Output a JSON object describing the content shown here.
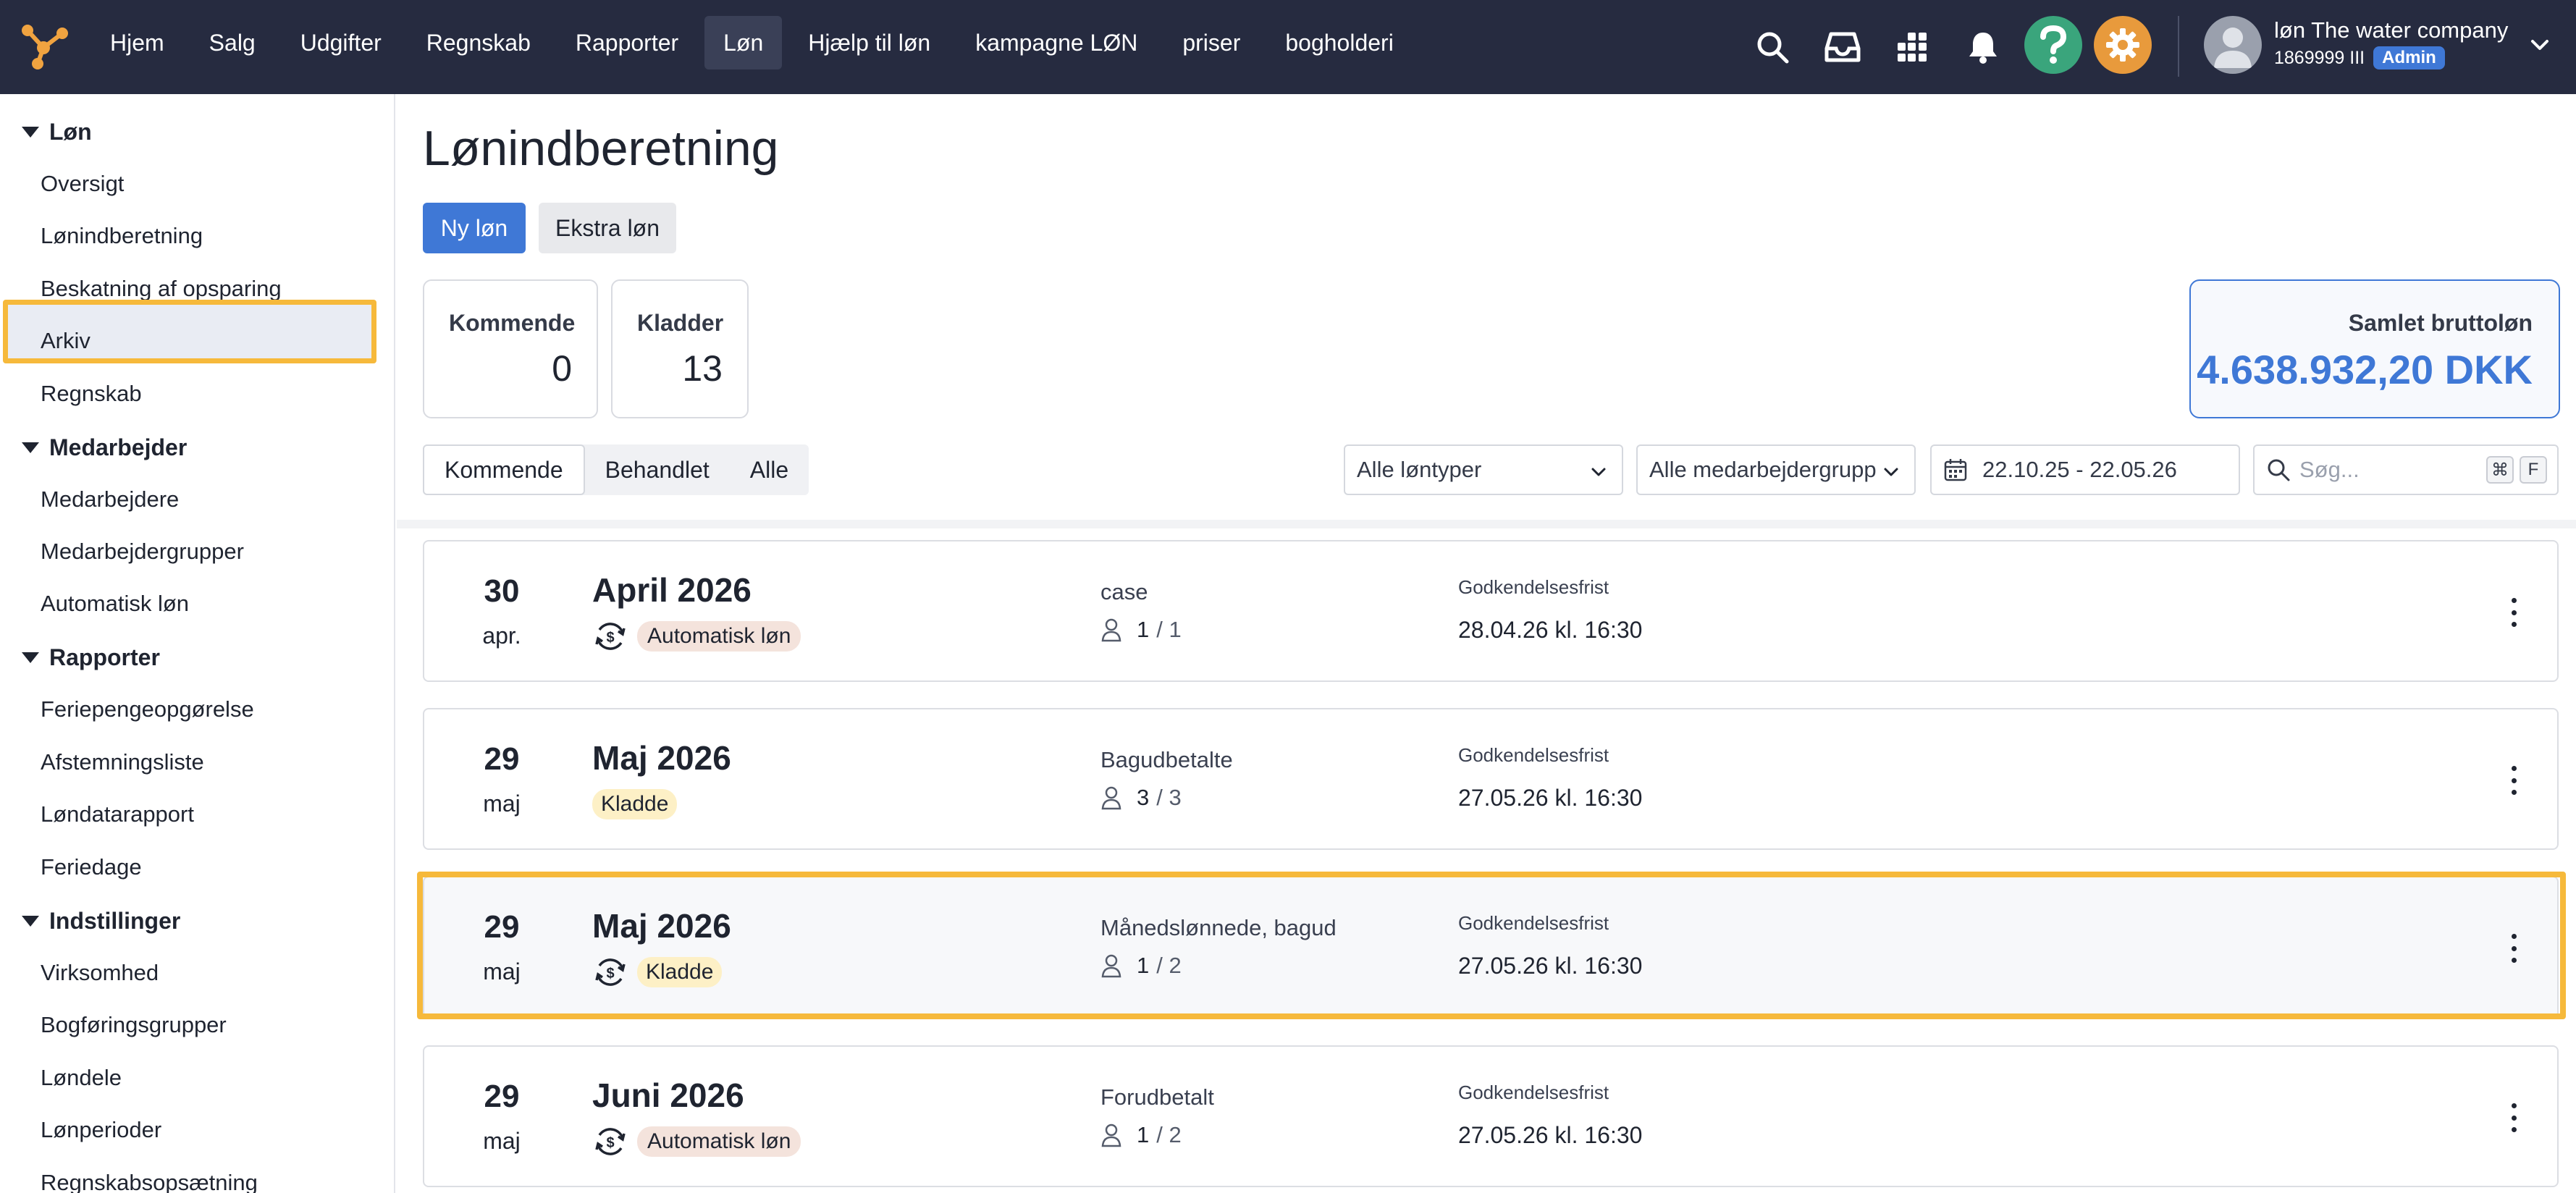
{
  "nav": {
    "items": [
      "Hjem",
      "Salg",
      "Udgifter",
      "Regnskab",
      "Rapporter",
      "Løn",
      "Hjælp til løn",
      "kampagne LØN",
      "priser",
      "bogholderi"
    ],
    "active": "Løn"
  },
  "icons": {
    "search": "search-icon",
    "inbox": "inbox-icon",
    "apps": "apps-grid-icon",
    "bell": "bell-icon",
    "help": "help-icon",
    "settings": "gear-icon"
  },
  "colors": {
    "topbar": "#262b40",
    "accent": "#3f78d6",
    "help": "#3aa57c",
    "settings": "#e89a3c",
    "highlight": "#f6b93b",
    "tag_auto": "#f4e3dc",
    "tag_draft": "#fdf0c6"
  },
  "user": {
    "name": "løn The water company",
    "id": "1869999 III",
    "role": "Admin"
  },
  "sidebar": {
    "groups": [
      {
        "label": "Løn",
        "items": [
          "Oversigt",
          "Lønindberetning",
          "Beskatning af opsparing",
          "Arkiv",
          "Regnskab"
        ]
      },
      {
        "label": "Medarbejder",
        "items": [
          "Medarbejdere",
          "Medarbejdergrupper",
          "Automatisk løn"
        ]
      },
      {
        "label": "Rapporter",
        "items": [
          "Feriepengeopgørelse",
          "Afstemningsliste",
          "Løndatarapport",
          "Feriedage"
        ]
      },
      {
        "label": "Indstillinger",
        "items": [
          "Virksomhed",
          "Bogføringsgrupper",
          "Løndele",
          "Lønperioder",
          "Regnskabsopsætning"
        ]
      }
    ],
    "active_item": "Lønindberetning"
  },
  "page": {
    "title": "Lønindberetning",
    "new_button": "Ny løn",
    "extra_button": "Ekstra løn"
  },
  "stats": {
    "upcoming_label": "Kommende",
    "upcoming_value": "0",
    "drafts_label": "Kladder",
    "drafts_value": "13",
    "total_label": "Samlet bruttoløn",
    "total_value": "4.638.932,20 DKK"
  },
  "filters": {
    "tabs": [
      "Kommende",
      "Behandlet",
      "Alle"
    ],
    "active_tab": "Kommende",
    "pay_types": "Alle løntyper",
    "employee_groups": "Alle medarbejdergrupp",
    "date_range": "22.10.25 - 22.05.26",
    "search_placeholder": "Søg...",
    "shortcut_keys": [
      "⌘",
      "F"
    ]
  },
  "payruns": [
    {
      "day": "30",
      "month": "apr.",
      "title": "April 2026",
      "auto": true,
      "tag": "Automatisk løn",
      "tag_type": "auto",
      "group": "case",
      "count": "1",
      "total": "/ 1",
      "deadline_label": "Godkendelsesfrist",
      "deadline": "28.04.26 kl. 16:30",
      "highlighted": false
    },
    {
      "day": "29",
      "month": "maj",
      "title": "Maj 2026",
      "auto": false,
      "tag": "Kladde",
      "tag_type": "draft",
      "group": "Bagudbetalte",
      "count": "3",
      "total": "/ 3",
      "deadline_label": "Godkendelsesfrist",
      "deadline": "27.05.26 kl. 16:30",
      "highlighted": false
    },
    {
      "day": "29",
      "month": "maj",
      "title": "Maj 2026",
      "auto": true,
      "tag": "Kladde",
      "tag_type": "draft",
      "group": "Månedslønnede, bagud",
      "count": "1",
      "total": "/ 2",
      "deadline_label": "Godkendelsesfrist",
      "deadline": "27.05.26 kl. 16:30",
      "highlighted": true
    },
    {
      "day": "29",
      "month": "maj",
      "title": "Juni 2026",
      "auto": true,
      "tag": "Automatisk løn",
      "tag_type": "auto",
      "group": "Forudbetalt",
      "count": "1",
      "total": "/ 2",
      "deadline_label": "Godkendelsesfrist",
      "deadline": "27.05.26 kl. 16:30",
      "highlighted": false
    }
  ]
}
